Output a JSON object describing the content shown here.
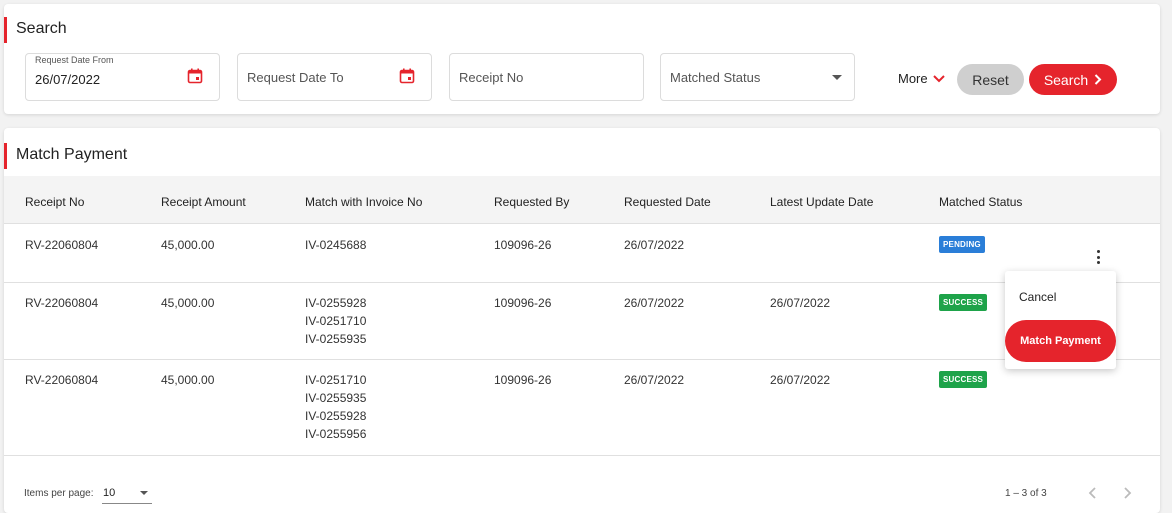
{
  "search": {
    "title": "Search",
    "fields": {
      "date_from_label": "Request Date From",
      "date_from_value": "26/07/2022",
      "date_to_placeholder": "Request Date To",
      "receipt_placeholder": "Receipt No",
      "status_placeholder": "Matched Status"
    },
    "more_label": "More",
    "reset_label": "Reset",
    "search_label": "Search"
  },
  "match": {
    "title": "Match Payment",
    "columns": [
      "Receipt No",
      "Receipt Amount",
      "Match with Invoice No",
      "Requested By",
      "Requested Date",
      "Latest Update Date",
      "Matched Status"
    ],
    "rows": [
      {
        "receipt": "RV-22060804",
        "amount": "45,000.00",
        "invoices": [
          "IV-0245688"
        ],
        "requested_by": "109096-26",
        "requested_date": "26/07/2022",
        "latest_update": "",
        "status": "PENDING"
      },
      {
        "receipt": "RV-22060804",
        "amount": "45,000.00",
        "invoices": [
          "IV-0255928",
          "IV-0251710",
          "IV-0255935"
        ],
        "requested_by": "109096-26",
        "requested_date": "26/07/2022",
        "latest_update": "26/07/2022",
        "status": "SUCCESS"
      },
      {
        "receipt": "RV-22060804",
        "amount": "45,000.00",
        "invoices": [
          "IV-0251710",
          "IV-0255935",
          "IV-0255928",
          "IV-0255956"
        ],
        "requested_by": "109096-26",
        "requested_date": "26/07/2022",
        "latest_update": "26/07/2022",
        "status": "SUCCESS"
      }
    ],
    "menu": {
      "cancel": "Cancel",
      "match_payment": "Match Payment"
    },
    "footer": {
      "items_per_page_label": "Items per page:",
      "items_per_page_value": "10",
      "range": "1 – 3 of 3"
    }
  },
  "icons": {
    "date_from": "calendar-icon",
    "date_to": "calendar-icon",
    "status_dropdown": "caret-down-icon",
    "more": "chevron-down-icon",
    "search": "chevron-right-icon",
    "row_actions": "kebab-icon",
    "prev_page": "chevron-left-icon",
    "next_page": "chevron-right-icon"
  },
  "colors": {
    "accent": "#e5242c",
    "pending": "#2a7ed8",
    "success": "#1ea34a",
    "reset_bg": "#cfcfcf"
  }
}
